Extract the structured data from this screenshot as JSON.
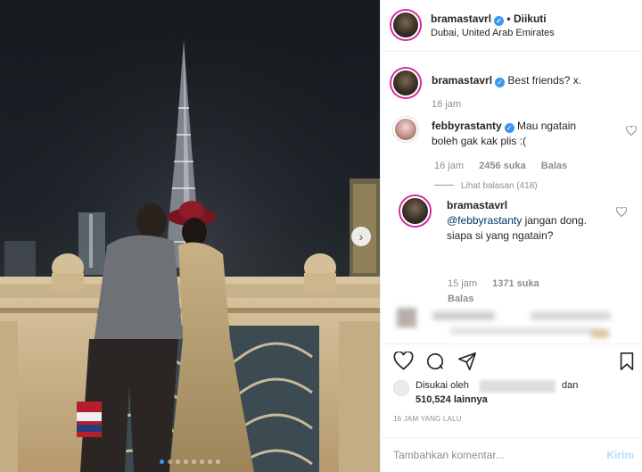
{
  "post": {
    "username": "bramastavrl",
    "follow_status": "Diikuti",
    "separator": "•",
    "location": "Dubai, United Arab Emirates",
    "verified_glyph": "✓"
  },
  "carousel": {
    "total_slides": 8,
    "active_slide": 1,
    "next_glyph": "›"
  },
  "caption": {
    "username": "bramastavrl",
    "text": "Best friends? x.",
    "time": "16 jam"
  },
  "comments": [
    {
      "username": "febbyrastanty",
      "text": "Mau ngatain boleh gak kak plis :(",
      "time": "16 jam",
      "likes": "2456 suka",
      "reply": "Balas"
    }
  ],
  "view_replies": "Lihat balasan (418)",
  "reply": {
    "username": "bramastavrl",
    "mention": "@febbyrastanty",
    "text": " jangan dong. siapa si yang ngatain?",
    "time": "15 jam",
    "likes": "1371 suka",
    "reply_label": "Balas"
  },
  "likes": {
    "prefix": "Disukai oleh",
    "conjunction": "dan",
    "count": "510,524 lainnya"
  },
  "timestamp": "16 JAM YANG LALU",
  "add_comment": {
    "placeholder": "Tambahkan komentar...",
    "send": "Kirim"
  },
  "icons": [
    "heart-icon",
    "comment-icon",
    "share-icon",
    "bookmark-icon",
    "verified-icon"
  ],
  "colors": {
    "accent": "#3897f0",
    "verified": "#3897f0",
    "muted": "#8e8e8e",
    "send_disabled": "#b2dffc"
  }
}
